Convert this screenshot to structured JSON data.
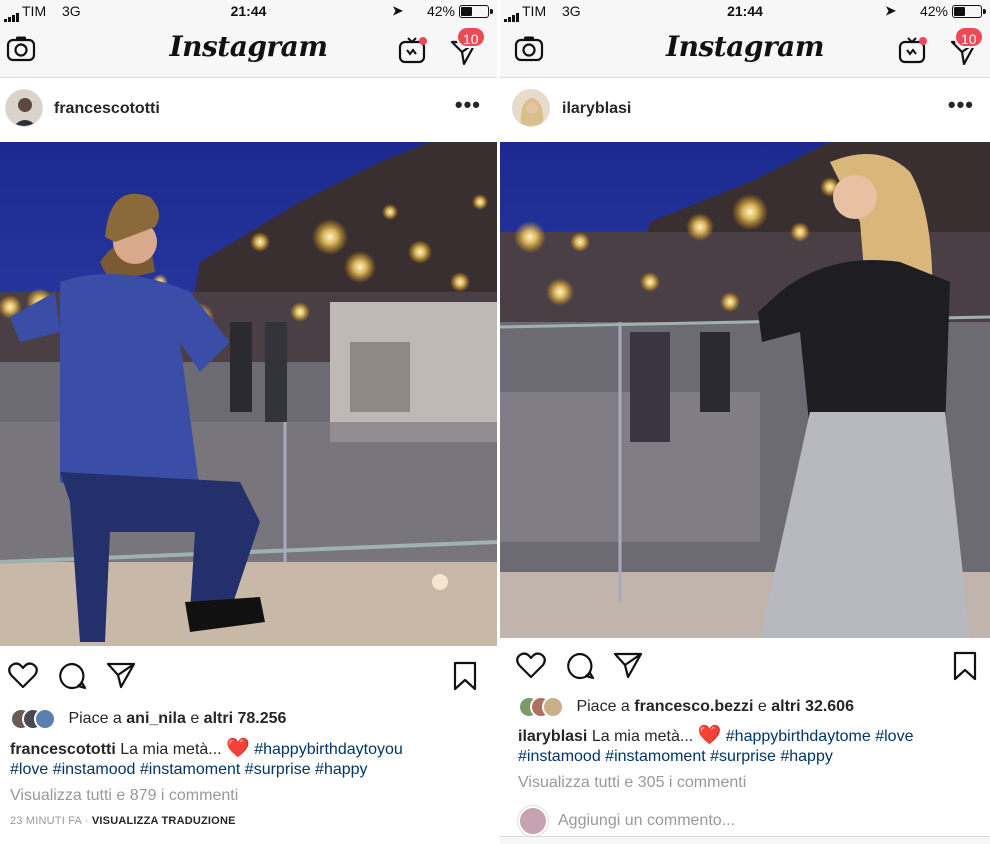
{
  "left": {
    "status": {
      "carrier": "TIM",
      "network": "3G",
      "time": "21:44",
      "battery_pct": "42%",
      "battery_level": 0.42
    },
    "nav": {
      "logo": "Instagram",
      "dm_badge": "10"
    },
    "post": {
      "username": "francescototti",
      "more": "•••",
      "likes_prefix": "Piace a",
      "likes_user": "ani_nila",
      "likes_mid": "e",
      "likes_count": "altri 78.256",
      "caption_user": "francescototti",
      "caption_text": "La mia metà...",
      "caption_heart": "❤️",
      "caption_tags_line1": "#happybirthdaytoyou",
      "caption_tags_line2": "#love #instamood #instamoment #surprise #happy",
      "view_comments": "Visualizza tutti e 879 i commenti",
      "time_ago": "23 MINUTI FA",
      "separator": "·",
      "translate": "VISUALIZZA TRADUZIONE"
    }
  },
  "right": {
    "status": {
      "carrier": "TIM",
      "network": "3G",
      "time": "21:44",
      "battery_pct": "42%",
      "battery_level": 0.42
    },
    "nav": {
      "logo": "Instagram",
      "dm_badge": "10"
    },
    "post": {
      "username": "ilaryblasi",
      "more": "•••",
      "likes_prefix": "Piace a",
      "likes_user": "francesco.bezzi",
      "likes_mid": "e",
      "likes_count": "altri 32.606",
      "caption_user": "ilaryblasi",
      "caption_text": "La mia metà...",
      "caption_heart": "❤️",
      "caption_tags_line1": "#happybirthdaytome #love",
      "caption_tags_line2": "#instamood #instamoment #surprise #happy",
      "view_comments": "Visualizza tutti e 305 i commenti",
      "add_comment": "Aggiungi un commento..."
    }
  },
  "colors": {
    "badge": "#ed4956",
    "hashtag": "#003569",
    "heart": "#e8192c",
    "muted": "#999999"
  },
  "icons": [
    "camera-icon",
    "igtv-icon",
    "direct-message-icon",
    "heart-icon",
    "comment-icon",
    "share-icon",
    "bookmark-icon",
    "more-icon"
  ]
}
